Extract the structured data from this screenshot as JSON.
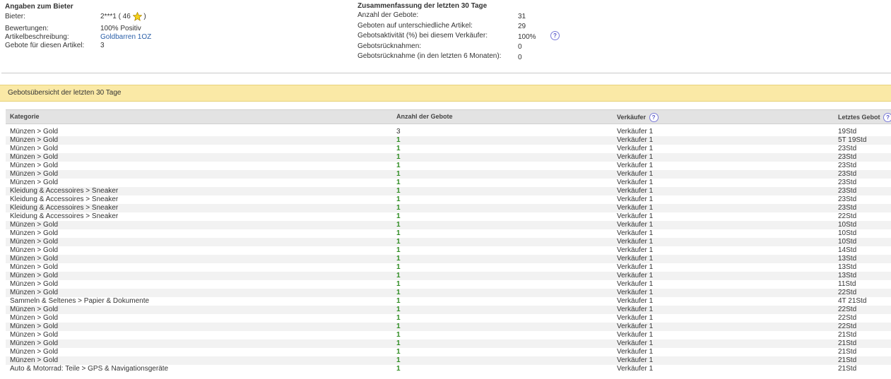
{
  "bidder": {
    "title": "Angaben zum Bieter",
    "bieter_label": "Bieter:",
    "bieter_value": "2***1 ( 46",
    "bieter_close": ")",
    "bewertungen_label": "Bewertungen:",
    "bewertungen_value": "100% Positiv",
    "artikel_label": "Artikelbeschreibung:",
    "artikel_value": "Goldbarren 1OZ",
    "gebote_label": "Gebote für diesen Artikel:",
    "gebote_value": "3"
  },
  "summary": {
    "title": "Zusammenfassung der letzten 30 Tage",
    "items": [
      {
        "label": "Anzahl der Gebote:",
        "value": "31"
      },
      {
        "label": "Geboten auf unterschiedliche Artikel:",
        "value": "29"
      },
      {
        "label": "Gebotsaktivität (%) bei diesem Verkäufer:",
        "value": "100%"
      },
      {
        "label": "Gebotsrücknahmen:",
        "value": "0"
      },
      {
        "label": "Gebotsrücknahme (in den letzten 6 Monaten):",
        "value": "0"
      }
    ]
  },
  "banner": "Gebotsübersicht der letzten 30 Tage",
  "table": {
    "headers": [
      "Kategorie",
      "Anzahl der Gebote",
      "Verkäufer",
      "Letztes Gebot"
    ],
    "rows": [
      [
        "Münzen > Gold",
        "3",
        "Verkäufer 1",
        "19Std"
      ],
      [
        "Münzen > Gold",
        "1",
        "Verkäufer 1",
        "5T 19Std"
      ],
      [
        "Münzen > Gold",
        "1",
        "Verkäufer 1",
        "23Std"
      ],
      [
        "Münzen > Gold",
        "1",
        "Verkäufer 1",
        "23Std"
      ],
      [
        "Münzen > Gold",
        "1",
        "Verkäufer 1",
        "23Std"
      ],
      [
        "Münzen > Gold",
        "1",
        "Verkäufer 1",
        "23Std"
      ],
      [
        "Münzen > Gold",
        "1",
        "Verkäufer 1",
        "23Std"
      ],
      [
        "Kleidung & Accessoires > Sneaker",
        "1",
        "Verkäufer 1",
        "23Std"
      ],
      [
        "Kleidung & Accessoires > Sneaker",
        "1",
        "Verkäufer 1",
        "23Std"
      ],
      [
        "Kleidung & Accessoires > Sneaker",
        "1",
        "Verkäufer 1",
        "23Std"
      ],
      [
        "Kleidung & Accessoires > Sneaker",
        "1",
        "Verkäufer 1",
        "22Std"
      ],
      [
        "Münzen > Gold",
        "1",
        "Verkäufer 1",
        "10Std"
      ],
      [
        "Münzen > Gold",
        "1",
        "Verkäufer 1",
        "10Std"
      ],
      [
        "Münzen > Gold",
        "1",
        "Verkäufer 1",
        "10Std"
      ],
      [
        "Münzen > Gold",
        "1",
        "Verkäufer 1",
        "14Std"
      ],
      [
        "Münzen > Gold",
        "1",
        "Verkäufer 1",
        "13Std"
      ],
      [
        "Münzen > Gold",
        "1",
        "Verkäufer 1",
        "13Std"
      ],
      [
        "Münzen > Gold",
        "1",
        "Verkäufer 1",
        "13Std"
      ],
      [
        "Münzen > Gold",
        "1",
        "Verkäufer 1",
        "11Std"
      ],
      [
        "Münzen > Gold",
        "1",
        "Verkäufer 1",
        "22Std"
      ],
      [
        "Sammeln & Seltenes > Papier & Dokumente",
        "1",
        "Verkäufer 1",
        "4T 21Std"
      ],
      [
        "Münzen > Gold",
        "1",
        "Verkäufer 1",
        "22Std"
      ],
      [
        "Münzen > Gold",
        "1",
        "Verkäufer 1",
        "22Std"
      ],
      [
        "Münzen > Gold",
        "1",
        "Verkäufer 1",
        "22Std"
      ],
      [
        "Münzen > Gold",
        "1",
        "Verkäufer 1",
        "21Std"
      ],
      [
        "Münzen > Gold",
        "1",
        "Verkäufer 1",
        "21Std"
      ],
      [
        "Münzen > Gold",
        "1",
        "Verkäufer 1",
        "21Std"
      ],
      [
        "Münzen > Gold",
        "1",
        "Verkäufer 1",
        "21Std"
      ],
      [
        "Auto & Motorrad: Teile > GPS & Navigationsgeräte",
        "1",
        "Verkäufer 1",
        "21Std"
      ]
    ]
  },
  "icons": {
    "help": "help-circle-icon",
    "star": "yellow-star-icon"
  },
  "colors": {
    "banner": "#fae9a6",
    "link": "#2a5fa8",
    "count_green": "#2c8a1f"
  }
}
